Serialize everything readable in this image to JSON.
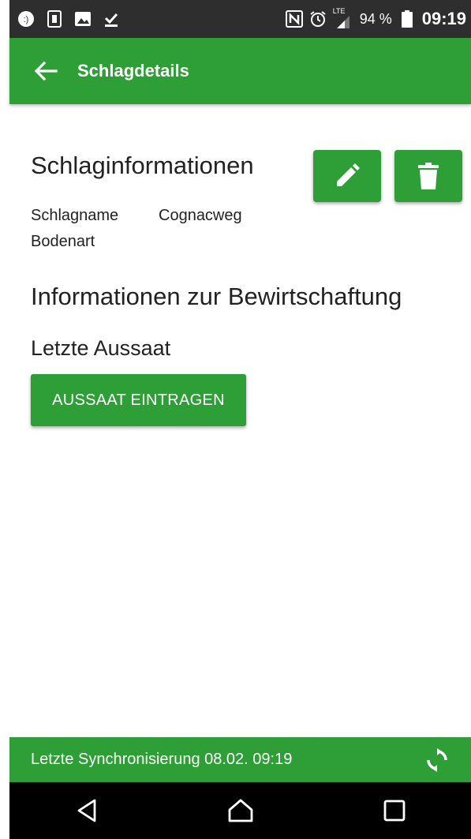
{
  "statusbar": {
    "battery_percent": "94 %",
    "time": "09:19",
    "network": "LTE",
    "icons_left": [
      "chat-icon",
      "battery-saver-icon",
      "image-icon",
      "download-done-icon"
    ],
    "icons_right": [
      "nfc-icon",
      "alarm-icon",
      "signal-icon",
      "battery-icon"
    ]
  },
  "appbar": {
    "title": "Schlagdetails",
    "back_icon": "arrow-left-icon"
  },
  "details": {
    "heading": "Schlaginformationen",
    "edit_icon": "pencil-icon",
    "delete_icon": "trash-icon",
    "fields": [
      {
        "label": "Schlagname",
        "value": "Cognacweg"
      },
      {
        "label": "Bodenart",
        "value": ""
      }
    ]
  },
  "management": {
    "heading": "Informationen zur Bewirtschaftung",
    "last_sowing_heading": "Letzte Aussaat",
    "add_sowing_button": "AUSSAAT EINTRAGEN"
  },
  "sync": {
    "text": "Letzte Synchronisierung 08.02. 09:19",
    "icon": "sync-icon"
  },
  "navbar": {
    "icons": [
      "back-triangle-icon",
      "home-icon",
      "recents-icon"
    ]
  },
  "colors": {
    "primary": "#2e9e36",
    "statusbar": "#2e2e2e",
    "navbar": "#000000"
  }
}
